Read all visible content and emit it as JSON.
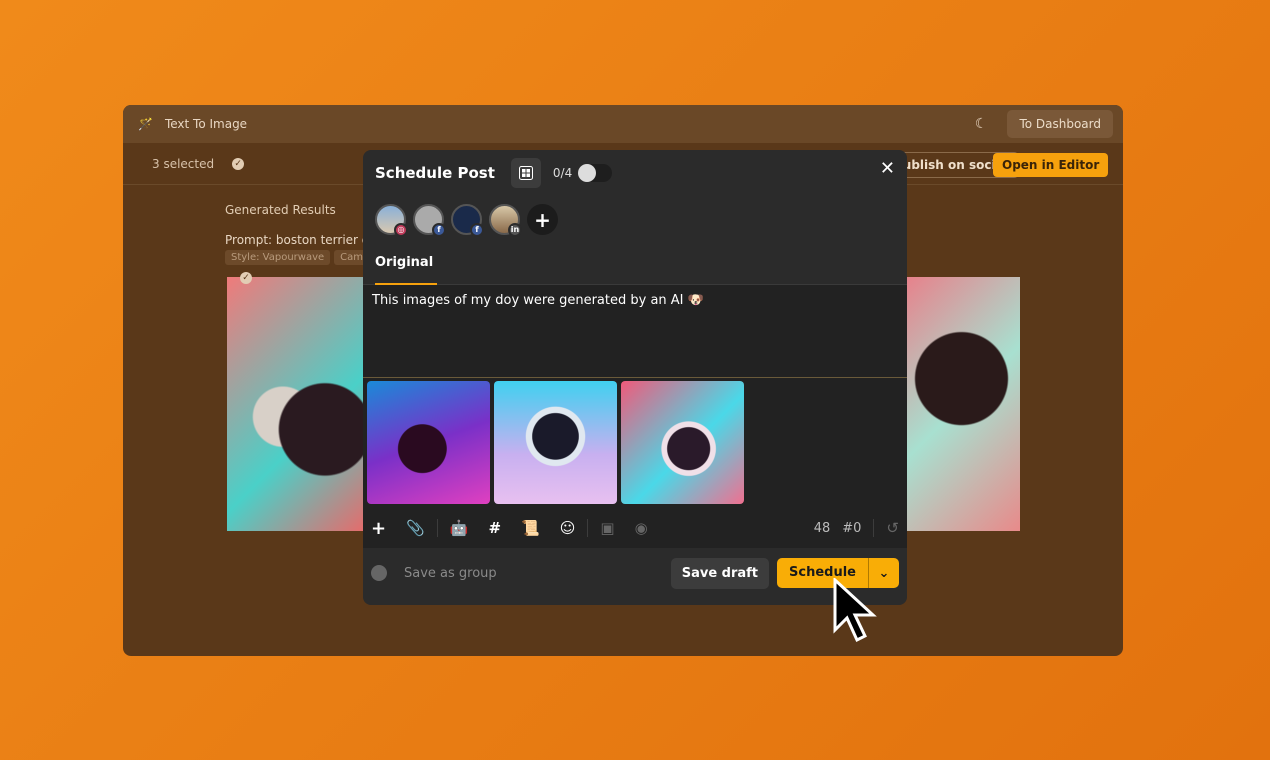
{
  "app": {
    "title": "Text To Image",
    "dashboard_label": "To Dashboard",
    "selected": "3 selected",
    "publish_label": "Publish on social",
    "open_editor_label": "Open in Editor",
    "results_title": "Generated Results",
    "prompt": "Prompt: boston terrier do",
    "tags": [
      "Style: Vapourwave",
      "Cam"
    ]
  },
  "modal": {
    "title": "Schedule Post",
    "count": "0/4",
    "tab": "Original",
    "text": "This images of my doy were generated by an AI 🐶",
    "accounts": [
      {
        "network": "instagram",
        "badge": "◎",
        "color": "#c13a5a"
      },
      {
        "network": "facebook",
        "badge": "f",
        "color": "#3b5998"
      },
      {
        "network": "facebook",
        "badge": "f",
        "color": "#3b5998"
      },
      {
        "network": "linkedin",
        "badge": "in",
        "color": "#555555"
      }
    ],
    "char_count": "48",
    "hashtag_count": "#0",
    "save_group": "Save as group",
    "save_draft": "Save draft",
    "schedule": "Schedule"
  },
  "colors": {
    "accent": "#f9ad06",
    "modal_bg": "#2b2b2b"
  }
}
